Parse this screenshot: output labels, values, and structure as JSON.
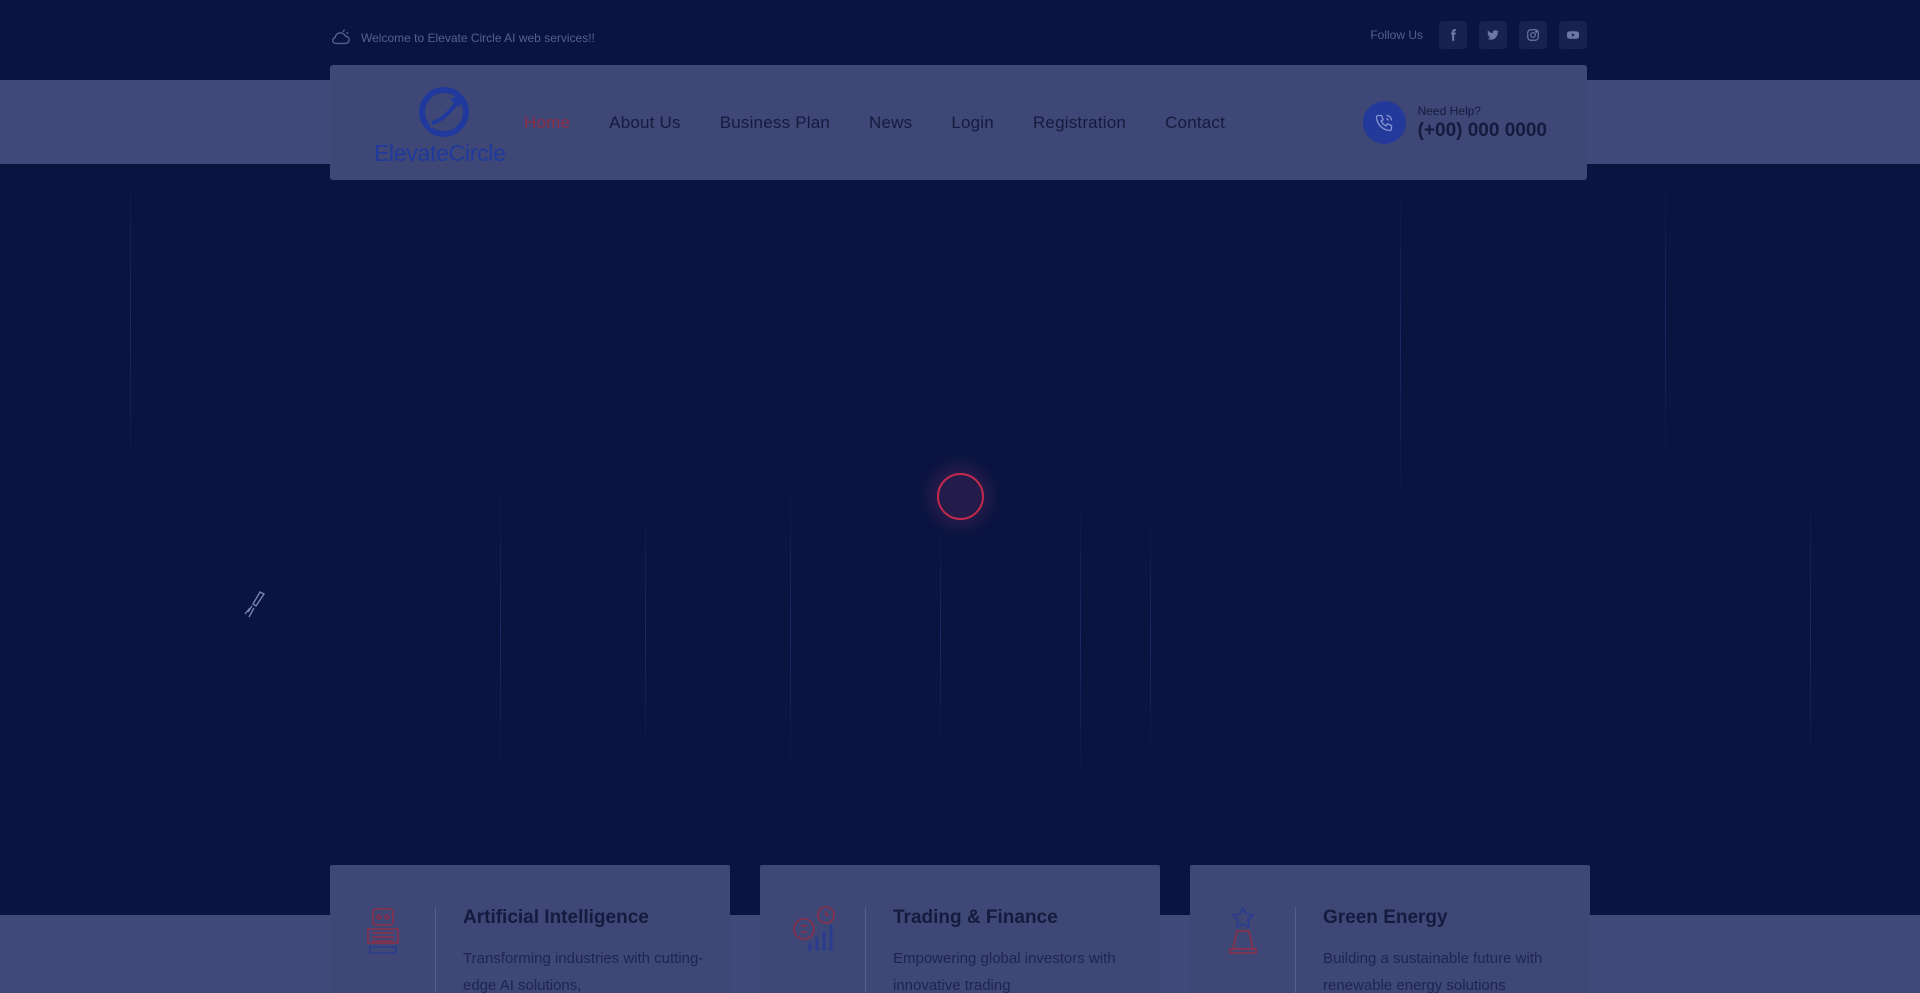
{
  "topbar": {
    "welcome_text": "Welcome to Elevate Circle AI web services!!",
    "follow_label": "Follow Us",
    "socials": [
      "facebook-icon",
      "twitter-icon",
      "instagram-icon",
      "youtube-icon"
    ]
  },
  "brand": {
    "name": "ElevateCircle"
  },
  "nav": {
    "items": [
      {
        "label": "Home",
        "active": true
      },
      {
        "label": "About Us"
      },
      {
        "label": "Business Plan"
      },
      {
        "label": "News"
      },
      {
        "label": "Login"
      },
      {
        "label": "Registration"
      },
      {
        "label": "Contact"
      }
    ]
  },
  "help": {
    "label": "Need Help?",
    "phone": "(+00) 000 0000"
  },
  "features": [
    {
      "title": "Artificial Intelligence",
      "text": "Transforming industries with cutting-edge AI solutions,"
    },
    {
      "title": "Trading & Finance",
      "text": "Empowering global investors with innovative trading"
    },
    {
      "title": "Green Energy",
      "text": "Building a sustainable future with renewable energy solutions"
    }
  ],
  "colors": {
    "background": "#0b1440",
    "overlay_panel": "#3e4775",
    "active_nav": "#8d2f4a",
    "loader_ring": "#c2294a",
    "brand_blue": "#1f3a9c"
  }
}
